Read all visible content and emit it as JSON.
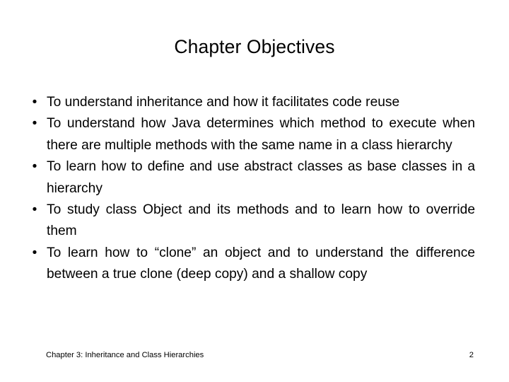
{
  "slide": {
    "title": "Chapter Objectives",
    "background_color": "#ffffff",
    "text_color": "#000000",
    "bullet_glyph": "•",
    "objectives": [
      {
        "text": "To understand inheritance and how it facilitates code reuse"
      },
      {
        "text": "To understand how Java determines which method to execute when there are multiple methods with the same name in a class hierarchy"
      },
      {
        "text": "To learn how to define and use abstract classes as base classes in a hierarchy"
      },
      {
        "text": "To study class Object and its methods and to learn how to override them"
      },
      {
        "text": "To learn how to “clone” an object and to understand the difference between a true clone (deep copy) and a shallow copy"
      }
    ],
    "footer": {
      "note": "Chapter 3: Inheritance and Class Hierarchies",
      "page_number": "2"
    }
  }
}
